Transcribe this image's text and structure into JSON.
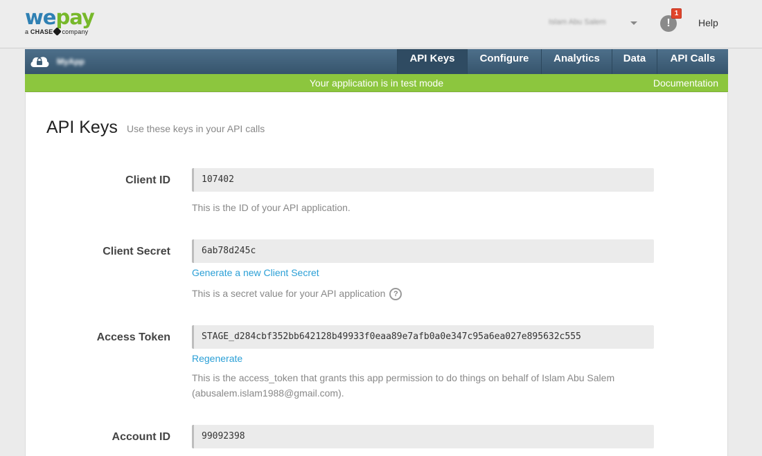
{
  "header": {
    "logo_we": "we",
    "logo_pay": "pay",
    "logo_tag_a": "a",
    "logo_tag_brand": "CHASE",
    "logo_tag_company": "company",
    "user_name": "Islam Abu Salem",
    "notification_count": "1",
    "alert_icon_glyph": "!",
    "help_label": "Help"
  },
  "appnav": {
    "app_name": "MyApp",
    "tabs": [
      {
        "label": "API Keys",
        "active": true
      },
      {
        "label": "Configure",
        "active": false
      },
      {
        "label": "Analytics",
        "active": false
      },
      {
        "label": "Data",
        "active": false
      },
      {
        "label": "API Calls",
        "active": false
      }
    ]
  },
  "testbar": {
    "message": "Your application is in test mode",
    "documentation_link": "Documentation",
    "color": "#8cc63e"
  },
  "page": {
    "title": "API Keys",
    "subtitle": "Use these keys in your API calls"
  },
  "fields": {
    "client_id": {
      "label": "Client ID",
      "value": "107402",
      "help": "This is the ID of your API application."
    },
    "client_secret": {
      "label": "Client Secret",
      "value": "6ab78d245c",
      "link": "Generate a new Client Secret",
      "help": "This is a secret value for your API application",
      "help_icon": "?"
    },
    "access_token": {
      "label": "Access Token",
      "value": "STAGE_d284cbf352bb642128b49933f0eaa89e7afb0a0e347c95a6ea027e895632c555",
      "link": "Regenerate",
      "help": "This is the access_token that grants this app permission to do things on behalf of Islam Abu Salem (abusalem.islam1988@gmail.com)."
    },
    "account_id": {
      "label": "Account ID",
      "value": "99092398"
    }
  },
  "colors": {
    "nav_bg": "#3f5f78",
    "link": "#2a9fd6",
    "logo_we": "#2f80b3",
    "logo_pay": "#77b82a",
    "badge": "#e0452b"
  }
}
